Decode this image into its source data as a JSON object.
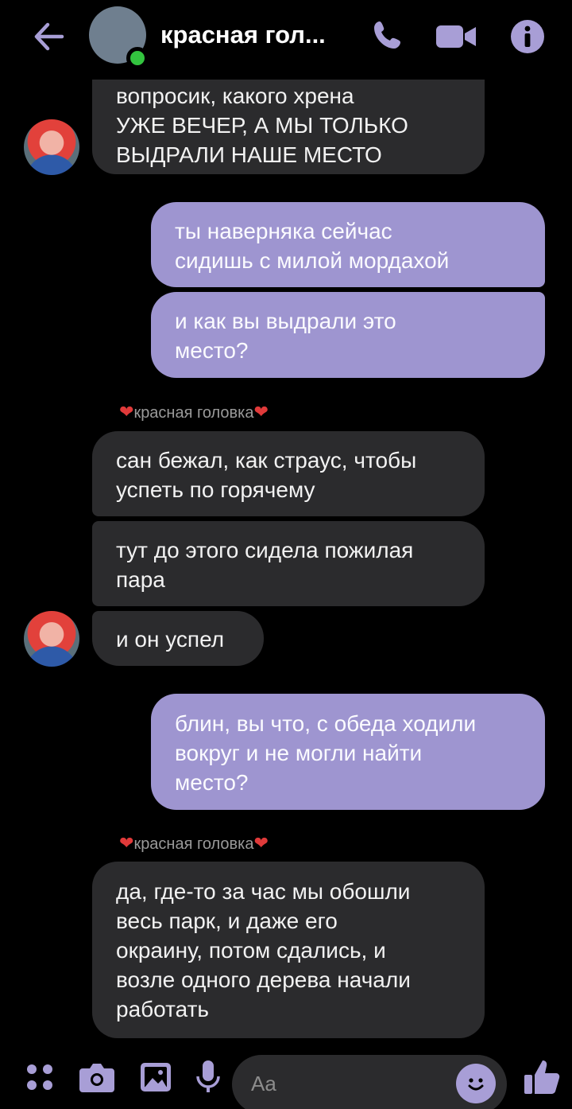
{
  "header": {
    "title": "красная гол...",
    "icons": [
      "back-arrow-icon",
      "phone-icon",
      "video-call-icon",
      "info-icon"
    ]
  },
  "messages": [
    {
      "from": "them",
      "lines": [
        "вопросик, какого хрена",
        "УЖЕ ВЕЧЕР, А МЫ ТОЛЬКО",
        "ВЫДРАЛИ НАШЕ МЕСТО"
      ]
    },
    {
      "from": "me",
      "lines": [
        "ты наверняка сейчас",
        "сидишь с милой мордахой"
      ]
    },
    {
      "from": "me",
      "lines": [
        "и как вы выдрали это",
        "место?"
      ]
    },
    {
      "sender_label": "красная головка"
    },
    {
      "from": "them",
      "lines": [
        "сан бежал, как страус, чтобы",
        "успеть по горячему"
      ]
    },
    {
      "from": "them",
      "lines": [
        "тут до этого сидела пожилая",
        "пара"
      ]
    },
    {
      "from": "them",
      "lines": [
        "и он успел"
      ]
    },
    {
      "from": "me",
      "lines": [
        "блин, вы что, с обеда ходили",
        "вокруг и не могли найти",
        "место?"
      ]
    },
    {
      "sender_label": "красная головка"
    },
    {
      "from": "them",
      "lines": [
        "да, где-то за час мы обошли",
        "весь парк, и даже его",
        "окраину, потом сдались, и",
        "возле одного дерева начали",
        "работать"
      ]
    }
  ],
  "composer": {
    "placeholder": "Aa",
    "icons": [
      "apps-icon",
      "camera-icon",
      "gallery-icon",
      "microphone-icon",
      "emoji-icon",
      "thumbs-up-icon"
    ]
  },
  "colors": {
    "background": "#000000",
    "incoming_bubble": "#2b2b2d",
    "outgoing_bubble": "#9e95d0",
    "accent": "#a89ed6",
    "online": "#33c43f"
  }
}
